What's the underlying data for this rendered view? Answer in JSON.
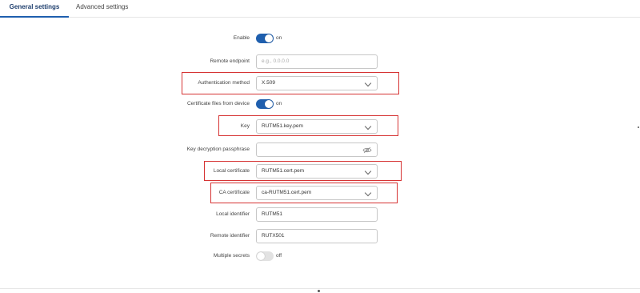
{
  "tabs": {
    "general": "General settings",
    "advanced": "Advanced settings"
  },
  "form": {
    "enable": {
      "label": "Enable",
      "state": "on",
      "enabled": true
    },
    "remote_endpoint": {
      "label": "Remote endpoint",
      "value": "",
      "placeholder": "e.g., 0.0.0.0"
    },
    "auth_method": {
      "label": "Authentication method",
      "value": "X.509"
    },
    "cert_from_device": {
      "label": "Certificate files from device",
      "state": "on",
      "enabled": true
    },
    "key": {
      "label": "Key",
      "value": "RUTM51.key.pem"
    },
    "key_passphrase": {
      "label": "Key decryption passphrase",
      "value": ""
    },
    "local_certificate": {
      "label": "Local certificate",
      "value": "RUTM51.cert.pem"
    },
    "ca_certificate": {
      "label": "CA certificate",
      "value": "ca-RUTM51.cert.pem"
    },
    "local_identifier": {
      "label": "Local identifier",
      "value": "RUTM51"
    },
    "remote_identifier": {
      "label": "Remote identifier",
      "value": "RUTX501"
    },
    "multiple_secrets": {
      "label": "Multiple secrets",
      "state": "off",
      "enabled": false
    }
  },
  "colors": {
    "accent": "#1f5fae",
    "highlight": "#d63333"
  }
}
